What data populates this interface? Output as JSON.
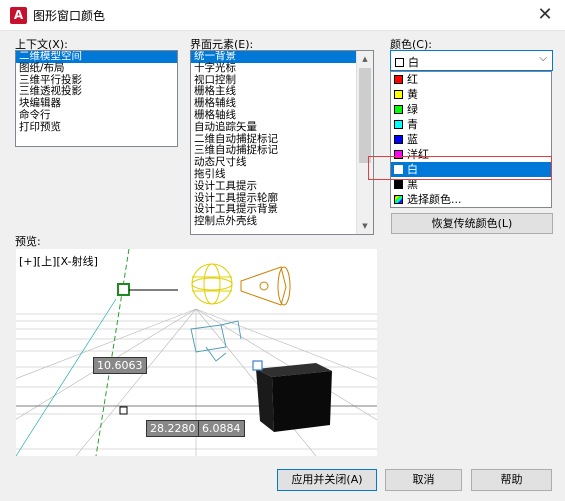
{
  "window": {
    "title": "图形窗口颜色",
    "app_icon": "A",
    "close": "✕"
  },
  "context": {
    "label": "上下文(X):",
    "items": [
      "二维模型空间",
      "图纸/布局",
      "三维平行投影",
      "三维透视投影",
      "块编辑器",
      "命令行",
      "打印预览"
    ],
    "selected_index": 0
  },
  "elements": {
    "label": "界面元素(E):",
    "items": [
      "统一背景",
      "十字光标",
      "视口控制",
      "栅格主线",
      "栅格辅线",
      "栅格轴线",
      "自动追踪矢量",
      "二维自动捕捉标记",
      "三维自动捕捉标记",
      "动态尺寸线",
      "拖引线",
      "设计工具提示",
      "设计工具提示轮廓",
      "设计工具提示背景",
      "控制点外壳线"
    ],
    "selected_index": 0
  },
  "color": {
    "label": "颜色(C):",
    "value": "白",
    "value_color": "#ffffff",
    "options": [
      {
        "label": "红",
        "color": "#ff0000"
      },
      {
        "label": "黄",
        "color": "#ffff00"
      },
      {
        "label": "绿",
        "color": "#00ff00"
      },
      {
        "label": "青",
        "color": "#00ffff"
      },
      {
        "label": "蓝",
        "color": "#0000ff"
      },
      {
        "label": "洋红",
        "color": "#ff00ff"
      },
      {
        "label": "白",
        "color": "#ffffff"
      },
      {
        "label": "黑",
        "color": "#000000"
      },
      {
        "label": "选择颜色...",
        "color": "multi"
      }
    ],
    "selected_index": 6
  },
  "restore_button": "恢复传统颜色(L)",
  "preview": {
    "label": "预览:",
    "viewport_label": "[+][上][X-射线]",
    "dim1": "10.6063",
    "dim2": "28.2280",
    "dim3": "6.0884"
  },
  "buttons": {
    "apply": "应用并关闭(A)",
    "cancel": "取消",
    "help": "帮助"
  }
}
